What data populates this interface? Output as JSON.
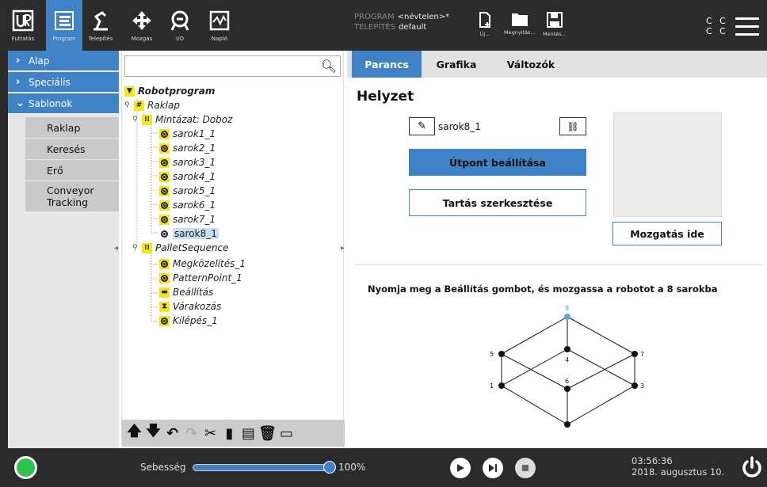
{
  "topbar": {
    "nav": [
      {
        "label": "Futtatás",
        "icon": "ur-logo-icon"
      },
      {
        "label": "Program",
        "icon": "program-icon",
        "active": true
      },
      {
        "label": "Telepítés",
        "icon": "robot-arm-icon"
      },
      {
        "label": "Mozgás",
        "icon": "move-arrows-icon"
      },
      {
        "label": "I/O",
        "icon": "io-icon"
      },
      {
        "label": "Napló",
        "icon": "log-icon"
      }
    ],
    "program_label": "PROGRAM",
    "program_value": "<névtelen>*",
    "install_label": "TELEPÍTÉS",
    "install_value": "default",
    "file_buttons": [
      {
        "label": "Új...",
        "icon": "new-file-icon"
      },
      {
        "label": "Megnyitás...",
        "icon": "folder-icon"
      },
      {
        "label": "Mentés...",
        "icon": "save-icon"
      }
    ],
    "cc_top": "C C",
    "cc_bottom": "C C"
  },
  "leftnav": {
    "items": [
      {
        "label": "Alap",
        "expanded": false
      },
      {
        "label": "Speciális",
        "expanded": false
      },
      {
        "label": "Sablonok",
        "expanded": true
      }
    ],
    "sub_items": [
      "Raklap",
      "Keresés",
      "Erő",
      "Conveyor Tracking"
    ]
  },
  "tree": {
    "search_placeholder": "",
    "nodes": [
      {
        "label": "Robotprogram",
        "icon": "flag-icon"
      },
      {
        "label": "Raklap",
        "icon": "pallet-grid-icon"
      },
      {
        "label": "Mintázat: Doboz",
        "icon": "pattern-icon"
      },
      {
        "label": "sarok1_1",
        "icon": "waypoint-icon"
      },
      {
        "label": "sarok2_1",
        "icon": "waypoint-icon"
      },
      {
        "label": "sarok3_1",
        "icon": "waypoint-icon"
      },
      {
        "label": "sarok4_1",
        "icon": "waypoint-icon"
      },
      {
        "label": "sarok5_1",
        "icon": "waypoint-icon"
      },
      {
        "label": "sarok6_1",
        "icon": "waypoint-icon"
      },
      {
        "label": "sarok7_1",
        "icon": "waypoint-icon"
      },
      {
        "label": "sarok8_1",
        "icon": "waypoint-icon",
        "selected": true
      },
      {
        "label": "PalletSequence",
        "icon": "pattern-icon"
      },
      {
        "label": "Megközelítés_1",
        "icon": "waypoint-icon"
      },
      {
        "label": "PatternPoint_1",
        "icon": "waypoint-icon"
      },
      {
        "label": "Beállítás",
        "icon": "set-icon"
      },
      {
        "label": "Várakozás",
        "icon": "hourglass-icon"
      },
      {
        "label": "Kilépés_1",
        "icon": "waypoint-icon"
      }
    ],
    "toolbar": [
      "move-up-icon",
      "move-down-icon",
      "undo-icon",
      "redo-icon",
      "cut-icon",
      "copy-icon",
      "paste-icon",
      "delete-icon",
      "suppress-icon"
    ]
  },
  "right": {
    "tabs": [
      "Parancs",
      "Grafika",
      "Változók"
    ],
    "active_tab": "Parancs",
    "heading": "Helyzet",
    "waypoint_name": "sarok8_1",
    "set_waypoint_label": "Útpont beállítása",
    "edit_hold_label": "Tartás szerkesztése",
    "move_here_label": "Mozgatás ide",
    "instruction": "Nyomja meg a Beállítás gombot, és mozgassa a robotot a 8 sarokba",
    "corners": [
      "1",
      "3",
      "4",
      "5",
      "6",
      "7",
      "8"
    ],
    "highlight_corner": "8",
    "highlight_color": "#5ba4e0"
  },
  "bottombar": {
    "speed_label": "Sebesség",
    "speed_value": "100%",
    "speed_fraction": 1.0,
    "time": "03:56:36",
    "date": "2018. augusztus 10.",
    "status_color": "#2ec24a"
  }
}
